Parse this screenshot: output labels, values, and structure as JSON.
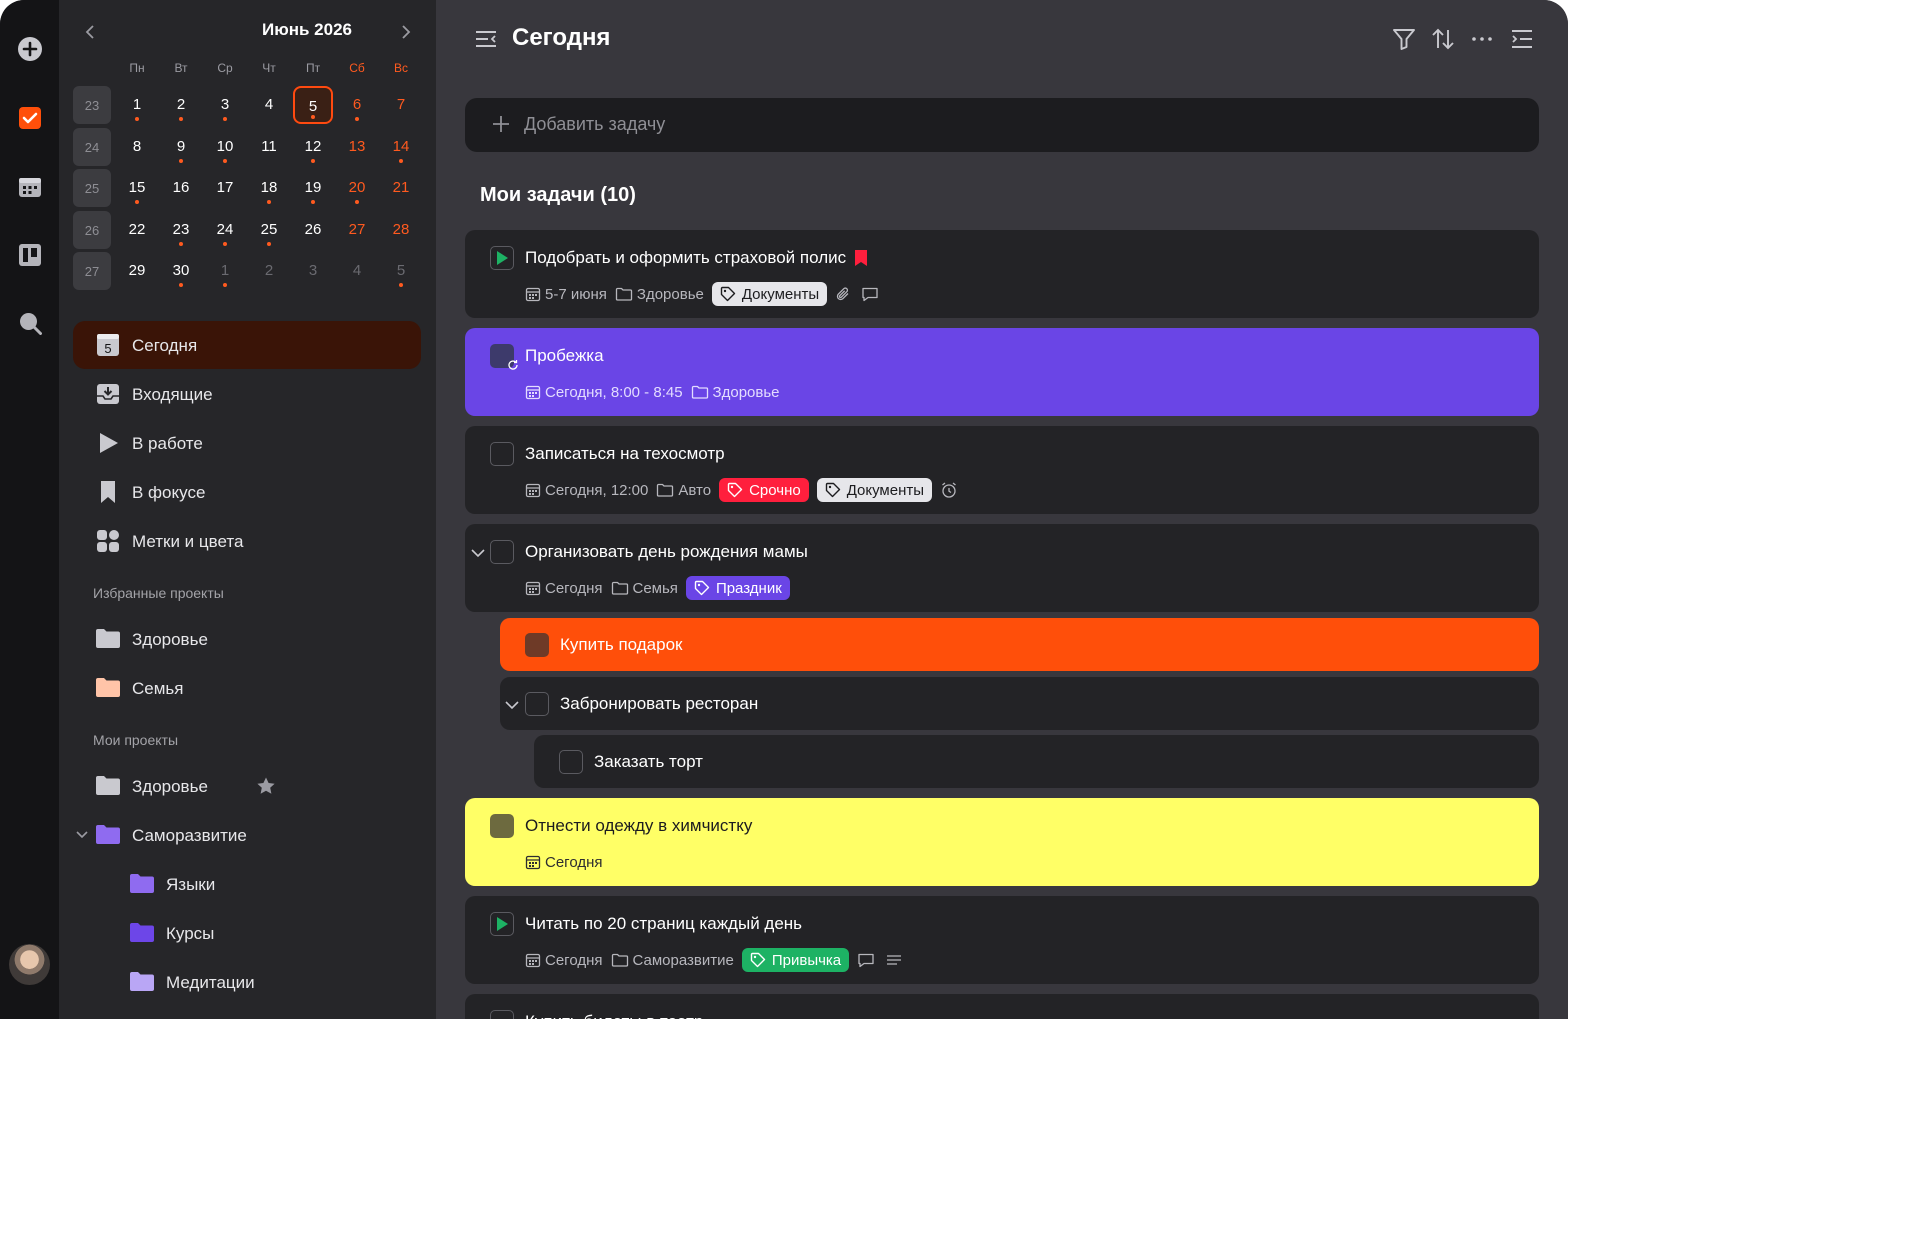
{
  "calendar": {
    "title": "Июнь 2026",
    "weekdays": [
      {
        "label": "Пн",
        "weekend": false
      },
      {
        "label": "Вт",
        "weekend": false
      },
      {
        "label": "Ср",
        "weekend": false
      },
      {
        "label": "Чт",
        "weekend": false
      },
      {
        "label": "Пт",
        "weekend": false
      },
      {
        "label": "Сб",
        "weekend": true
      },
      {
        "label": "Вс",
        "weekend": true
      }
    ],
    "weeks": [
      {
        "number": "23",
        "days": [
          {
            "d": "1",
            "dot": true
          },
          {
            "d": "2",
            "dot": true
          },
          {
            "d": "3",
            "dot": true
          },
          {
            "d": "4",
            "dot": false
          },
          {
            "d": "5",
            "dot": true,
            "today": true
          },
          {
            "d": "6",
            "dot": true,
            "weekend": true
          },
          {
            "d": "7",
            "dot": false,
            "weekend": true
          }
        ]
      },
      {
        "number": "24",
        "days": [
          {
            "d": "8",
            "dot": false
          },
          {
            "d": "9",
            "dot": true
          },
          {
            "d": "10",
            "dot": true
          },
          {
            "d": "11",
            "dot": false
          },
          {
            "d": "12",
            "dot": true
          },
          {
            "d": "13",
            "dot": false,
            "weekend": true
          },
          {
            "d": "14",
            "dot": true,
            "weekend": true
          }
        ]
      },
      {
        "number": "25",
        "days": [
          {
            "d": "15",
            "dot": true
          },
          {
            "d": "16",
            "dot": false
          },
          {
            "d": "17",
            "dot": false
          },
          {
            "d": "18",
            "dot": true
          },
          {
            "d": "19",
            "dot": true
          },
          {
            "d": "20",
            "dot": true,
            "weekend": true
          },
          {
            "d": "21",
            "dot": false,
            "weekend": true
          }
        ]
      },
      {
        "number": "26",
        "days": [
          {
            "d": "22",
            "dot": false
          },
          {
            "d": "23",
            "dot": true
          },
          {
            "d": "24",
            "dot": true
          },
          {
            "d": "25",
            "dot": true
          },
          {
            "d": "26",
            "dot": false
          },
          {
            "d": "27",
            "dot": false,
            "weekend": true
          },
          {
            "d": "28",
            "dot": false,
            "weekend": true
          }
        ]
      },
      {
        "number": "27",
        "days": [
          {
            "d": "29",
            "dot": false
          },
          {
            "d": "30",
            "dot": true
          },
          {
            "d": "1",
            "dot": true,
            "other": true
          },
          {
            "d": "2",
            "dot": false,
            "other": true
          },
          {
            "d": "3",
            "dot": false,
            "other": true
          },
          {
            "d": "4",
            "dot": false,
            "other": true
          },
          {
            "d": "5",
            "dot": true,
            "other": true
          }
        ]
      }
    ]
  },
  "nav": {
    "today": {
      "label": "Сегодня",
      "badge": "5"
    },
    "inbox": "Входящие",
    "in_progress": "В работе",
    "focus": "В фокусе",
    "tags": "Метки и цвета"
  },
  "favorites": {
    "title": "Избранные проекты",
    "items": [
      {
        "label": "Здоровье",
        "color": "#c9c9cf"
      },
      {
        "label": "Семья",
        "color": "#ffc4a8"
      }
    ]
  },
  "projects": {
    "title": "Мои проекты",
    "items": [
      {
        "label": "Здоровье",
        "color": "#c9c9cf",
        "starred": true
      },
      {
        "label": "Саморазвитие",
        "color": "#8f6bf0",
        "expanded": true
      },
      {
        "label": "Языки",
        "color": "#8f6bf0",
        "child": true
      },
      {
        "label": "Курсы",
        "color": "#6d46e8",
        "child": true
      },
      {
        "label": "Медитации",
        "color": "#b9a6f5",
        "child": true
      }
    ]
  },
  "header": {
    "title": "Сегодня"
  },
  "add_task": {
    "placeholder": "Добавить задачу"
  },
  "tasks_header": "Мои задачи (10)",
  "tasks": [
    {
      "title": "Подобрать и оформить страховой полис",
      "state": "in-progress",
      "flag": true,
      "date": "5-7 июня",
      "project": "Здоровье",
      "tags": [
        {
          "label": "Документы",
          "bg": "#e6e6ea",
          "fg": "#1c1c1f"
        }
      ],
      "attachment": true,
      "comment": true
    },
    {
      "title": "Пробежка",
      "bg": "#6a45e6",
      "recurring": true,
      "date": "Сегодня, 8:00 - 8:45",
      "project": "Здоровье",
      "tags": []
    },
    {
      "title": "Записаться на техосмотр",
      "date": "Сегодня, 12:00",
      "project": "Авто",
      "tags": [
        {
          "label": "Срочно",
          "bg": "#ff1f3d",
          "fg": "#ffffff"
        },
        {
          "label": "Документы",
          "bg": "#e6e6ea",
          "fg": "#1c1c1f"
        }
      ],
      "alarm": true
    },
    {
      "title": "Организовать день рождения мамы",
      "expand": true,
      "date": "Сегодня",
      "project": "Семья",
      "tags": [
        {
          "label": "Праздник",
          "bg": "#6a45e6",
          "fg": "#ffffff"
        }
      ]
    },
    {
      "title": "Купить подарок",
      "bg": "#ff4f0a",
      "level": 1
    },
    {
      "title": "Забронировать ресторан",
      "level": 1,
      "expand": true
    },
    {
      "title": "Заказать торт",
      "level": 2
    },
    {
      "title": "Отнести одежду в химчистку",
      "bg": "#ffff66",
      "dark_text": true,
      "date": "Сегодня"
    },
    {
      "title": "Читать по 20 страниц каждый день",
      "state": "in-progress",
      "date": "Сегодня",
      "project": "Саморазвитие",
      "tags": [
        {
          "label": "Привычка",
          "bg": "#1db264",
          "fg": "#ffffff"
        }
      ],
      "comment": true,
      "notes": true
    },
    {
      "title": "Купить билеты в театр"
    }
  ],
  "colors": {
    "accent": "#ff4f0a",
    "rail_active": "#ff4f0a",
    "weekend": "#ff5a1f",
    "in_progress_green": "#1db264"
  },
  "icons": [
    "add-icon",
    "checkbox-icon",
    "calendar-icon",
    "board-icon",
    "search-icon",
    "filter-icon",
    "sort-icon",
    "more-icon",
    "sidebar-toggle-icon"
  ]
}
